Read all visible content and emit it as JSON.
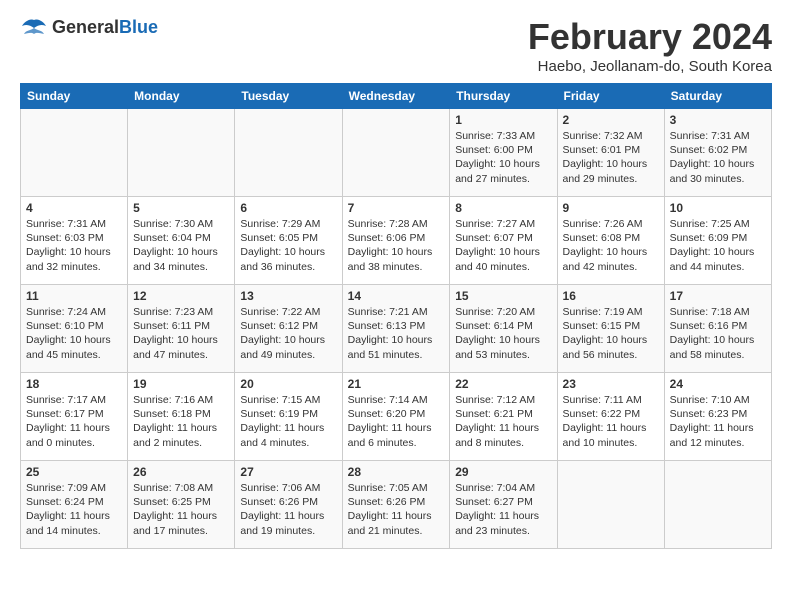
{
  "logo": {
    "general": "General",
    "blue": "Blue"
  },
  "title": "February 2024",
  "subtitle": "Haebo, Jeollanam-do, South Korea",
  "days_of_week": [
    "Sunday",
    "Monday",
    "Tuesday",
    "Wednesday",
    "Thursday",
    "Friday",
    "Saturday"
  ],
  "weeks": [
    [
      {
        "day": "",
        "info": ""
      },
      {
        "day": "",
        "info": ""
      },
      {
        "day": "",
        "info": ""
      },
      {
        "day": "",
        "info": ""
      },
      {
        "day": "1",
        "info": "Sunrise: 7:33 AM\nSunset: 6:00 PM\nDaylight: 10 hours\nand 27 minutes."
      },
      {
        "day": "2",
        "info": "Sunrise: 7:32 AM\nSunset: 6:01 PM\nDaylight: 10 hours\nand 29 minutes."
      },
      {
        "day": "3",
        "info": "Sunrise: 7:31 AM\nSunset: 6:02 PM\nDaylight: 10 hours\nand 30 minutes."
      }
    ],
    [
      {
        "day": "4",
        "info": "Sunrise: 7:31 AM\nSunset: 6:03 PM\nDaylight: 10 hours\nand 32 minutes."
      },
      {
        "day": "5",
        "info": "Sunrise: 7:30 AM\nSunset: 6:04 PM\nDaylight: 10 hours\nand 34 minutes."
      },
      {
        "day": "6",
        "info": "Sunrise: 7:29 AM\nSunset: 6:05 PM\nDaylight: 10 hours\nand 36 minutes."
      },
      {
        "day": "7",
        "info": "Sunrise: 7:28 AM\nSunset: 6:06 PM\nDaylight: 10 hours\nand 38 minutes."
      },
      {
        "day": "8",
        "info": "Sunrise: 7:27 AM\nSunset: 6:07 PM\nDaylight: 10 hours\nand 40 minutes."
      },
      {
        "day": "9",
        "info": "Sunrise: 7:26 AM\nSunset: 6:08 PM\nDaylight: 10 hours\nand 42 minutes."
      },
      {
        "day": "10",
        "info": "Sunrise: 7:25 AM\nSunset: 6:09 PM\nDaylight: 10 hours\nand 44 minutes."
      }
    ],
    [
      {
        "day": "11",
        "info": "Sunrise: 7:24 AM\nSunset: 6:10 PM\nDaylight: 10 hours\nand 45 minutes."
      },
      {
        "day": "12",
        "info": "Sunrise: 7:23 AM\nSunset: 6:11 PM\nDaylight: 10 hours\nand 47 minutes."
      },
      {
        "day": "13",
        "info": "Sunrise: 7:22 AM\nSunset: 6:12 PM\nDaylight: 10 hours\nand 49 minutes."
      },
      {
        "day": "14",
        "info": "Sunrise: 7:21 AM\nSunset: 6:13 PM\nDaylight: 10 hours\nand 51 minutes."
      },
      {
        "day": "15",
        "info": "Sunrise: 7:20 AM\nSunset: 6:14 PM\nDaylight: 10 hours\nand 53 minutes."
      },
      {
        "day": "16",
        "info": "Sunrise: 7:19 AM\nSunset: 6:15 PM\nDaylight: 10 hours\nand 56 minutes."
      },
      {
        "day": "17",
        "info": "Sunrise: 7:18 AM\nSunset: 6:16 PM\nDaylight: 10 hours\nand 58 minutes."
      }
    ],
    [
      {
        "day": "18",
        "info": "Sunrise: 7:17 AM\nSunset: 6:17 PM\nDaylight: 11 hours\nand 0 minutes."
      },
      {
        "day": "19",
        "info": "Sunrise: 7:16 AM\nSunset: 6:18 PM\nDaylight: 11 hours\nand 2 minutes."
      },
      {
        "day": "20",
        "info": "Sunrise: 7:15 AM\nSunset: 6:19 PM\nDaylight: 11 hours\nand 4 minutes."
      },
      {
        "day": "21",
        "info": "Sunrise: 7:14 AM\nSunset: 6:20 PM\nDaylight: 11 hours\nand 6 minutes."
      },
      {
        "day": "22",
        "info": "Sunrise: 7:12 AM\nSunset: 6:21 PM\nDaylight: 11 hours\nand 8 minutes."
      },
      {
        "day": "23",
        "info": "Sunrise: 7:11 AM\nSunset: 6:22 PM\nDaylight: 11 hours\nand 10 minutes."
      },
      {
        "day": "24",
        "info": "Sunrise: 7:10 AM\nSunset: 6:23 PM\nDaylight: 11 hours\nand 12 minutes."
      }
    ],
    [
      {
        "day": "25",
        "info": "Sunrise: 7:09 AM\nSunset: 6:24 PM\nDaylight: 11 hours\nand 14 minutes."
      },
      {
        "day": "26",
        "info": "Sunrise: 7:08 AM\nSunset: 6:25 PM\nDaylight: 11 hours\nand 17 minutes."
      },
      {
        "day": "27",
        "info": "Sunrise: 7:06 AM\nSunset: 6:26 PM\nDaylight: 11 hours\nand 19 minutes."
      },
      {
        "day": "28",
        "info": "Sunrise: 7:05 AM\nSunset: 6:26 PM\nDaylight: 11 hours\nand 21 minutes."
      },
      {
        "day": "29",
        "info": "Sunrise: 7:04 AM\nSunset: 6:27 PM\nDaylight: 11 hours\nand 23 minutes."
      },
      {
        "day": "",
        "info": ""
      },
      {
        "day": "",
        "info": ""
      }
    ]
  ]
}
